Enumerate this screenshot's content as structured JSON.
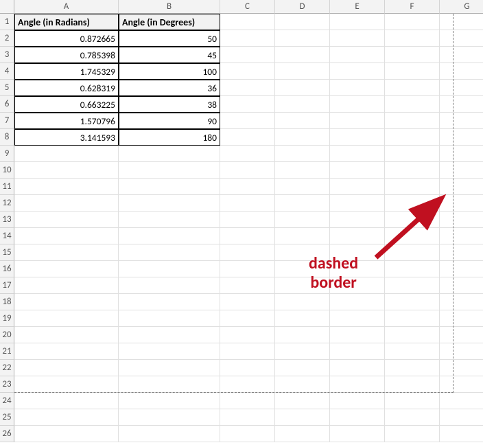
{
  "columns": [
    "A",
    "B",
    "C",
    "D",
    "E",
    "F",
    "G"
  ],
  "rowCount": 26,
  "headers": {
    "A": "Angle (in Radians)",
    "B": "Angle (in Degrees)"
  },
  "rows": [
    {
      "radians": "0.872665",
      "degrees": "50"
    },
    {
      "radians": "0.785398",
      "degrees": "45"
    },
    {
      "radians": "1.745329",
      "degrees": "100"
    },
    {
      "radians": "0.628319",
      "degrees": "36"
    },
    {
      "radians": "0.663225",
      "degrees": "38"
    },
    {
      "radians": "1.570796",
      "degrees": "90"
    },
    {
      "radians": "3.141593",
      "degrees": "180"
    }
  ],
  "annotation": {
    "line1": "dashed",
    "line2": "border"
  }
}
